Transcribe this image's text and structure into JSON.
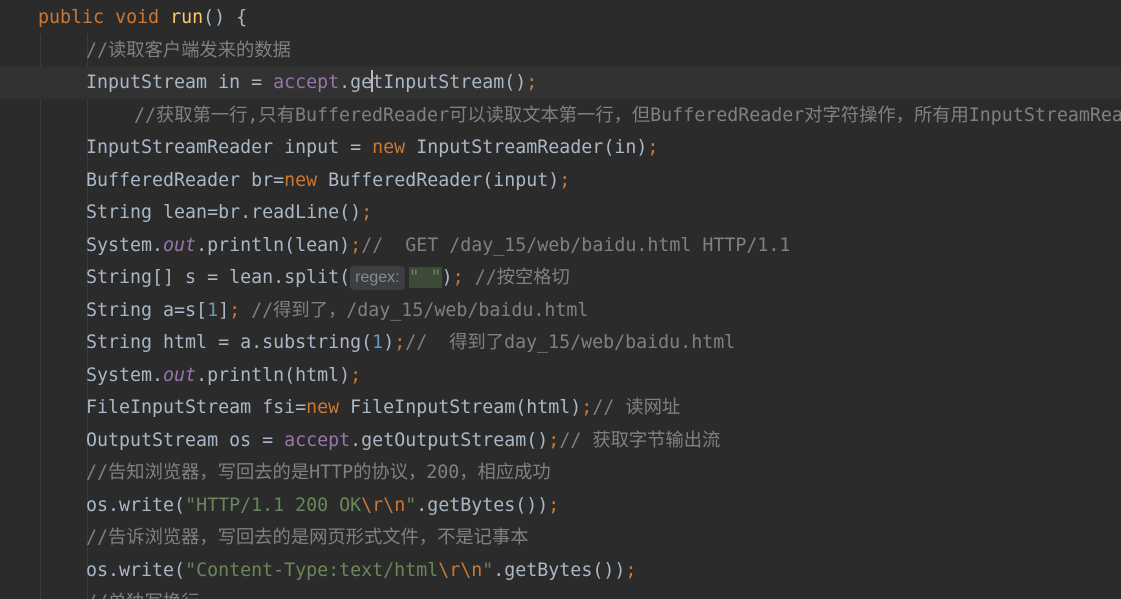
{
  "editor": {
    "caret_line": 2,
    "lines": [
      {
        "indent": 0,
        "tokens": [
          {
            "t": "kw",
            "v": "public"
          },
          {
            "t": "plain",
            "v": " "
          },
          {
            "t": "kw",
            "v": "void"
          },
          {
            "t": "plain",
            "v": " "
          },
          {
            "t": "fn",
            "v": "run"
          },
          {
            "t": "plain",
            "v": "() {"
          }
        ]
      },
      {
        "indent": 1,
        "tokens": [
          {
            "t": "cmt",
            "v": "//读取客户端发来的数据"
          }
        ]
      },
      {
        "indent": 1,
        "tokens": [
          {
            "t": "plain",
            "v": "InputStream in = "
          },
          {
            "t": "field",
            "v": "accept"
          },
          {
            "t": "plain",
            "v": ".ge"
          },
          {
            "t": "caret",
            "v": ""
          },
          {
            "t": "plain",
            "v": "tInputStream()"
          },
          {
            "t": "kw",
            "v": ";"
          }
        ]
      },
      {
        "indent": 2,
        "tokens": [
          {
            "t": "cmt",
            "v": "//获取第一行,只有BufferedReader可以读取文本第一行，但BufferedReader对字符操作，所有用InputStreamReader转换"
          }
        ]
      },
      {
        "indent": 1,
        "tokens": [
          {
            "t": "plain",
            "v": "InputStreamReader input = "
          },
          {
            "t": "kw",
            "v": "new"
          },
          {
            "t": "plain",
            "v": " InputStreamReader(in)"
          },
          {
            "t": "kw",
            "v": ";"
          }
        ]
      },
      {
        "indent": 1,
        "tokens": [
          {
            "t": "plain",
            "v": "BufferedReader br="
          },
          {
            "t": "kw",
            "v": "new"
          },
          {
            "t": "plain",
            "v": " BufferedReader(input)"
          },
          {
            "t": "kw",
            "v": ";"
          }
        ]
      },
      {
        "indent": 1,
        "tokens": [
          {
            "t": "plain",
            "v": "String lean=br.readLine()"
          },
          {
            "t": "kw",
            "v": ";"
          }
        ]
      },
      {
        "indent": 1,
        "tokens": [
          {
            "t": "plain",
            "v": "System."
          },
          {
            "t": "static",
            "v": "out"
          },
          {
            "t": "plain",
            "v": ".println(lean)"
          },
          {
            "t": "kw",
            "v": ";"
          },
          {
            "t": "cmt",
            "v": "//  GET /day_15/web/baidu.html HTTP/1.1"
          }
        ]
      },
      {
        "indent": 1,
        "tokens": [
          {
            "t": "plain",
            "v": "String[] s = lean.split("
          },
          {
            "t": "hint",
            "v": "regex:"
          },
          {
            "t": "strhl",
            "v": "\" \""
          },
          {
            "t": "plain",
            "v": ")"
          },
          {
            "t": "kw",
            "v": ";"
          },
          {
            "t": "plain",
            "v": " "
          },
          {
            "t": "cmt",
            "v": "//按空格切"
          }
        ]
      },
      {
        "indent": 1,
        "tokens": [
          {
            "t": "plain",
            "v": "String a=s["
          },
          {
            "t": "num",
            "v": "1"
          },
          {
            "t": "plain",
            "v": "]"
          },
          {
            "t": "kw",
            "v": ";"
          },
          {
            "t": "plain",
            "v": " "
          },
          {
            "t": "cmt",
            "v": "//得到了，/day_15/web/baidu.html"
          }
        ]
      },
      {
        "indent": 1,
        "tokens": [
          {
            "t": "plain",
            "v": "String html = a.substring("
          },
          {
            "t": "num",
            "v": "1"
          },
          {
            "t": "plain",
            "v": ")"
          },
          {
            "t": "kw",
            "v": ";"
          },
          {
            "t": "cmt",
            "v": "//  得到了day_15/web/baidu.html"
          }
        ]
      },
      {
        "indent": 1,
        "tokens": [
          {
            "t": "plain",
            "v": "System."
          },
          {
            "t": "static",
            "v": "out"
          },
          {
            "t": "plain",
            "v": ".println(html)"
          },
          {
            "t": "kw",
            "v": ";"
          }
        ]
      },
      {
        "indent": 1,
        "tokens": [
          {
            "t": "plain",
            "v": "FileInputStream fsi="
          },
          {
            "t": "kw",
            "v": "new"
          },
          {
            "t": "plain",
            "v": " FileInputStream(html)"
          },
          {
            "t": "kw",
            "v": ";"
          },
          {
            "t": "cmt",
            "v": "// 读网址"
          }
        ]
      },
      {
        "indent": 1,
        "tokens": [
          {
            "t": "plain",
            "v": "OutputStream os = "
          },
          {
            "t": "field",
            "v": "accept"
          },
          {
            "t": "plain",
            "v": ".getOutputStream()"
          },
          {
            "t": "kw",
            "v": ";"
          },
          {
            "t": "cmt",
            "v": "// 获取字节输出流"
          }
        ]
      },
      {
        "indent": 1,
        "tokens": [
          {
            "t": "cmt",
            "v": "//告知浏览器，写回去的是HTTP的协议，200，相应成功"
          }
        ]
      },
      {
        "indent": 1,
        "tokens": [
          {
            "t": "plain",
            "v": "os.write("
          },
          {
            "t": "str",
            "v": "\"HTTP/1.1 200 OK"
          },
          {
            "t": "esc",
            "v": "\\r\\n"
          },
          {
            "t": "str",
            "v": "\""
          },
          {
            "t": "plain",
            "v": ".getBytes())"
          },
          {
            "t": "kw",
            "v": ";"
          }
        ]
      },
      {
        "indent": 1,
        "tokens": [
          {
            "t": "cmt",
            "v": "//告诉浏览器，写回去的是网页形式文件，不是记事本"
          }
        ]
      },
      {
        "indent": 1,
        "tokens": [
          {
            "t": "plain",
            "v": "os.write("
          },
          {
            "t": "str",
            "v": "\"Content-Type:text/html"
          },
          {
            "t": "esc",
            "v": "\\r\\n"
          },
          {
            "t": "str",
            "v": "\""
          },
          {
            "t": "plain",
            "v": ".getBytes())"
          },
          {
            "t": "kw",
            "v": ";"
          }
        ]
      },
      {
        "indent": 1,
        "tokens": [
          {
            "t": "cmt",
            "v": "//单独写换行"
          }
        ]
      }
    ]
  }
}
